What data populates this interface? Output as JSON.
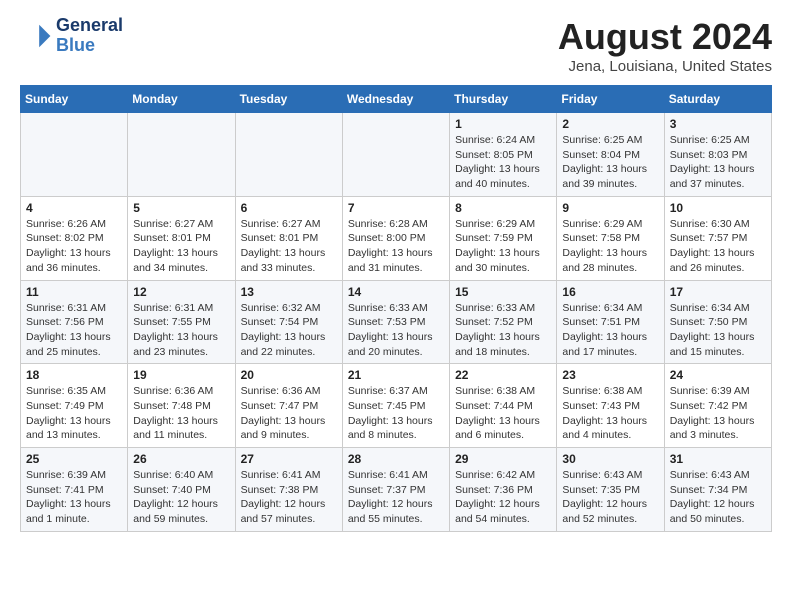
{
  "logo": {
    "line1": "General",
    "line2": "Blue"
  },
  "title": "August 2024",
  "subtitle": "Jena, Louisiana, United States",
  "days_of_week": [
    "Sunday",
    "Monday",
    "Tuesday",
    "Wednesday",
    "Thursday",
    "Friday",
    "Saturday"
  ],
  "weeks": [
    [
      {
        "num": "",
        "info": ""
      },
      {
        "num": "",
        "info": ""
      },
      {
        "num": "",
        "info": ""
      },
      {
        "num": "",
        "info": ""
      },
      {
        "num": "1",
        "info": "Sunrise: 6:24 AM\nSunset: 8:05 PM\nDaylight: 13 hours and 40 minutes."
      },
      {
        "num": "2",
        "info": "Sunrise: 6:25 AM\nSunset: 8:04 PM\nDaylight: 13 hours and 39 minutes."
      },
      {
        "num": "3",
        "info": "Sunrise: 6:25 AM\nSunset: 8:03 PM\nDaylight: 13 hours and 37 minutes."
      }
    ],
    [
      {
        "num": "4",
        "info": "Sunrise: 6:26 AM\nSunset: 8:02 PM\nDaylight: 13 hours and 36 minutes."
      },
      {
        "num": "5",
        "info": "Sunrise: 6:27 AM\nSunset: 8:01 PM\nDaylight: 13 hours and 34 minutes."
      },
      {
        "num": "6",
        "info": "Sunrise: 6:27 AM\nSunset: 8:01 PM\nDaylight: 13 hours and 33 minutes."
      },
      {
        "num": "7",
        "info": "Sunrise: 6:28 AM\nSunset: 8:00 PM\nDaylight: 13 hours and 31 minutes."
      },
      {
        "num": "8",
        "info": "Sunrise: 6:29 AM\nSunset: 7:59 PM\nDaylight: 13 hours and 30 minutes."
      },
      {
        "num": "9",
        "info": "Sunrise: 6:29 AM\nSunset: 7:58 PM\nDaylight: 13 hours and 28 minutes."
      },
      {
        "num": "10",
        "info": "Sunrise: 6:30 AM\nSunset: 7:57 PM\nDaylight: 13 hours and 26 minutes."
      }
    ],
    [
      {
        "num": "11",
        "info": "Sunrise: 6:31 AM\nSunset: 7:56 PM\nDaylight: 13 hours and 25 minutes."
      },
      {
        "num": "12",
        "info": "Sunrise: 6:31 AM\nSunset: 7:55 PM\nDaylight: 13 hours and 23 minutes."
      },
      {
        "num": "13",
        "info": "Sunrise: 6:32 AM\nSunset: 7:54 PM\nDaylight: 13 hours and 22 minutes."
      },
      {
        "num": "14",
        "info": "Sunrise: 6:33 AM\nSunset: 7:53 PM\nDaylight: 13 hours and 20 minutes."
      },
      {
        "num": "15",
        "info": "Sunrise: 6:33 AM\nSunset: 7:52 PM\nDaylight: 13 hours and 18 minutes."
      },
      {
        "num": "16",
        "info": "Sunrise: 6:34 AM\nSunset: 7:51 PM\nDaylight: 13 hours and 17 minutes."
      },
      {
        "num": "17",
        "info": "Sunrise: 6:34 AM\nSunset: 7:50 PM\nDaylight: 13 hours and 15 minutes."
      }
    ],
    [
      {
        "num": "18",
        "info": "Sunrise: 6:35 AM\nSunset: 7:49 PM\nDaylight: 13 hours and 13 minutes."
      },
      {
        "num": "19",
        "info": "Sunrise: 6:36 AM\nSunset: 7:48 PM\nDaylight: 13 hours and 11 minutes."
      },
      {
        "num": "20",
        "info": "Sunrise: 6:36 AM\nSunset: 7:47 PM\nDaylight: 13 hours and 9 minutes."
      },
      {
        "num": "21",
        "info": "Sunrise: 6:37 AM\nSunset: 7:45 PM\nDaylight: 13 hours and 8 minutes."
      },
      {
        "num": "22",
        "info": "Sunrise: 6:38 AM\nSunset: 7:44 PM\nDaylight: 13 hours and 6 minutes."
      },
      {
        "num": "23",
        "info": "Sunrise: 6:38 AM\nSunset: 7:43 PM\nDaylight: 13 hours and 4 minutes."
      },
      {
        "num": "24",
        "info": "Sunrise: 6:39 AM\nSunset: 7:42 PM\nDaylight: 13 hours and 3 minutes."
      }
    ],
    [
      {
        "num": "25",
        "info": "Sunrise: 6:39 AM\nSunset: 7:41 PM\nDaylight: 13 hours and 1 minute."
      },
      {
        "num": "26",
        "info": "Sunrise: 6:40 AM\nSunset: 7:40 PM\nDaylight: 12 hours and 59 minutes."
      },
      {
        "num": "27",
        "info": "Sunrise: 6:41 AM\nSunset: 7:38 PM\nDaylight: 12 hours and 57 minutes."
      },
      {
        "num": "28",
        "info": "Sunrise: 6:41 AM\nSunset: 7:37 PM\nDaylight: 12 hours and 55 minutes."
      },
      {
        "num": "29",
        "info": "Sunrise: 6:42 AM\nSunset: 7:36 PM\nDaylight: 12 hours and 54 minutes."
      },
      {
        "num": "30",
        "info": "Sunrise: 6:43 AM\nSunset: 7:35 PM\nDaylight: 12 hours and 52 minutes."
      },
      {
        "num": "31",
        "info": "Sunrise: 6:43 AM\nSunset: 7:34 PM\nDaylight: 12 hours and 50 minutes."
      }
    ]
  ]
}
